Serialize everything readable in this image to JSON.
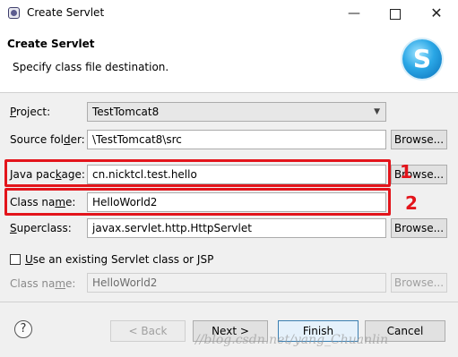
{
  "window": {
    "title": "Create Servlet",
    "minimize_glyph": "—",
    "close_glyph": "✕"
  },
  "header": {
    "title": "Create Servlet",
    "description": "Specify class file destination.",
    "logo_letter": "S"
  },
  "form": {
    "project": {
      "label_pre": "",
      "label_u": "P",
      "label_post": "roject:",
      "value": "TestTomcat8"
    },
    "source_folder": {
      "label_pre": "Source fol",
      "label_u": "d",
      "label_post": "er:",
      "value": "\\TestTomcat8\\src",
      "browse": "Browse..."
    },
    "java_package": {
      "label_pre": "Java pac",
      "label_u": "k",
      "label_post": "age:",
      "value": "cn.nicktcl.test.hello",
      "browse": "Browse..."
    },
    "class_name": {
      "label_pre": "Class na",
      "label_u": "m",
      "label_post": "e:",
      "value": "HelloWorld2"
    },
    "superclass": {
      "label_pre": "",
      "label_u": "S",
      "label_post": "uperclass:",
      "value": "javax.servlet.http.HttpServlet",
      "browse": "Browse..."
    },
    "use_existing": {
      "label_pre": "",
      "label_u": "U",
      "label_post": "se an existing Servlet class or JSP",
      "checked": false
    },
    "existing_class": {
      "label_pre": "Class na",
      "label_u": "m",
      "label_post": "e:",
      "value": "HelloWorld2",
      "browse": "Browse..."
    }
  },
  "annotations": {
    "one": "1",
    "two": "2",
    "color": "#e3141b"
  },
  "buttons": {
    "help": "?",
    "back": "< Back",
    "next": "Next >",
    "finish": "Finish",
    "cancel": "Cancel"
  },
  "watermark": "//blog.csdn.net/yang_Chuanlin"
}
